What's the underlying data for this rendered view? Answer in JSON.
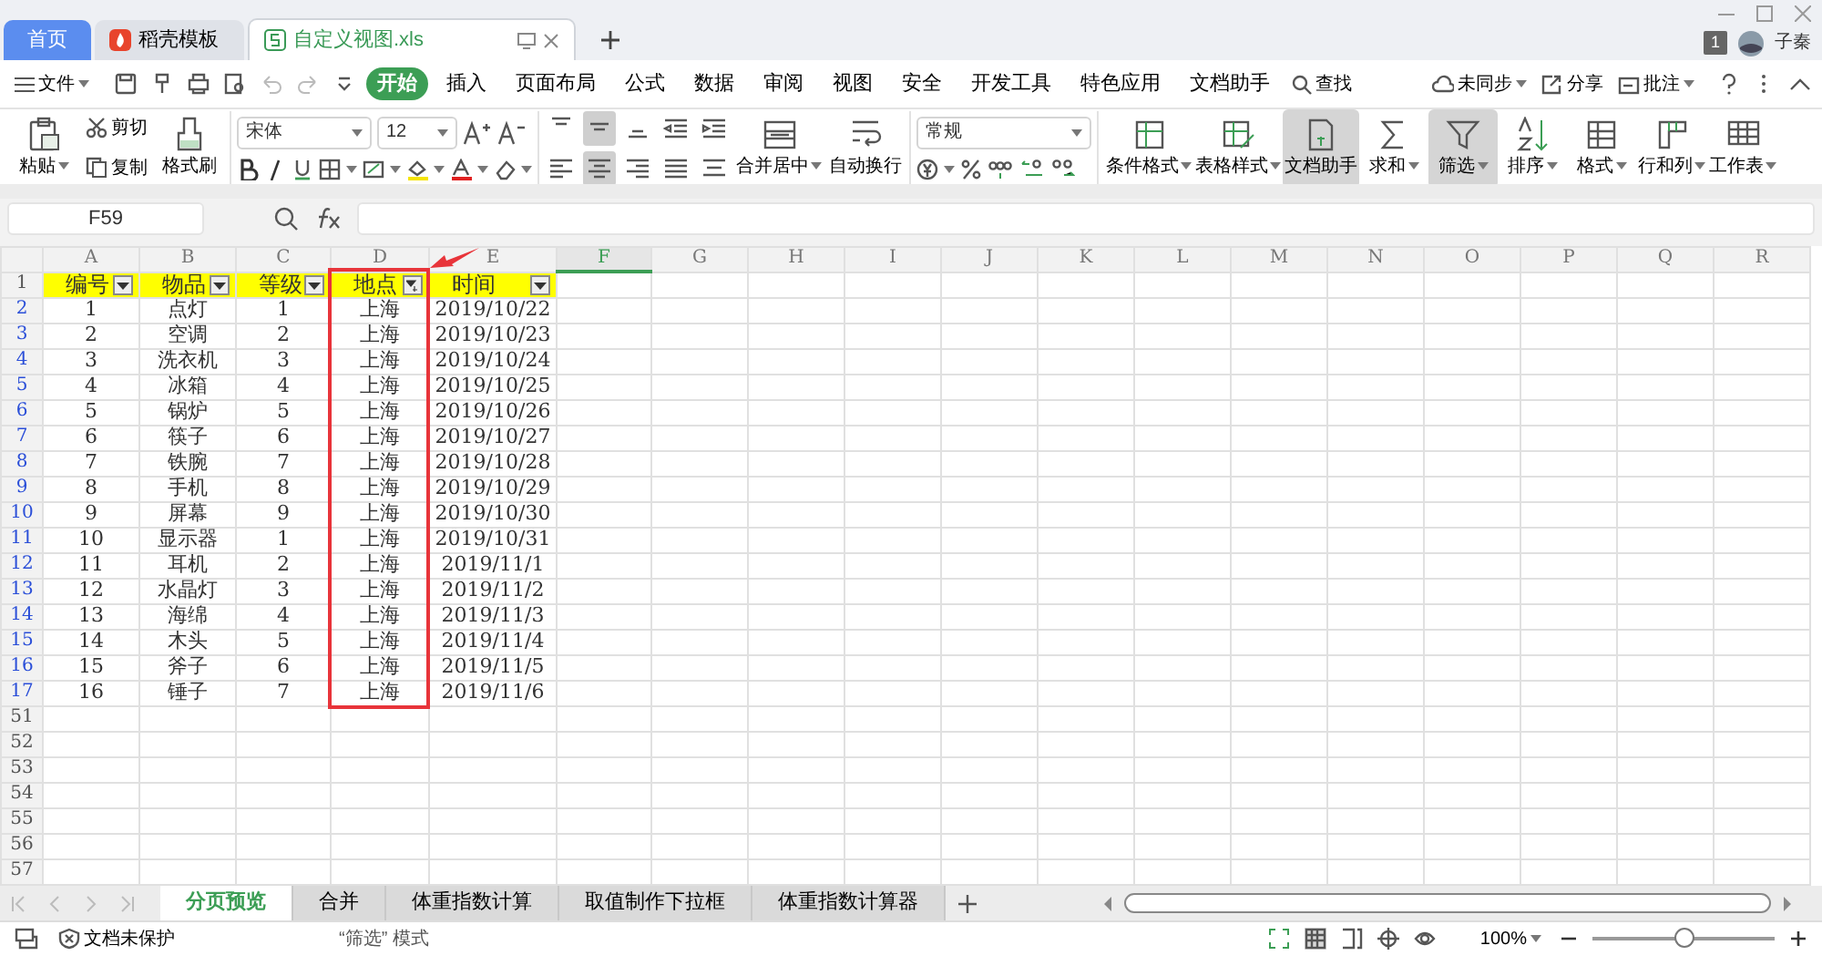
{
  "window": {
    "tabs": [
      {
        "label": "首页",
        "selected": false,
        "kind": "home"
      },
      {
        "label": "稻壳模板",
        "selected": false,
        "kind": "docer"
      },
      {
        "label": "自定义视图.xls",
        "selected": true,
        "kind": "file"
      }
    ],
    "badge": "1",
    "user": "子秦"
  },
  "menu": {
    "file": "文件",
    "tabs": [
      {
        "label": "开始",
        "selected": true
      },
      {
        "label": "插入",
        "selected": false
      },
      {
        "label": "页面布局",
        "selected": false
      },
      {
        "label": "公式",
        "selected": false
      },
      {
        "label": "数据",
        "selected": false
      },
      {
        "label": "审阅",
        "selected": false
      },
      {
        "label": "视图",
        "selected": false
      },
      {
        "label": "安全",
        "selected": false
      },
      {
        "label": "开发工具",
        "selected": false
      },
      {
        "label": "特色应用",
        "selected": false
      },
      {
        "label": "文档助手",
        "selected": false
      }
    ],
    "search": "查找",
    "sync": "未同步",
    "share": "分享",
    "comment": "批注"
  },
  "ribbon": {
    "paste": "粘贴",
    "cut": "剪切",
    "copy": "复制",
    "format_painter": "格式刷",
    "font_name": "宋体",
    "font_size": "12",
    "align_icons": [
      {
        "selected": false
      },
      {
        "selected": true
      },
      {
        "selected": false
      },
      {
        "selected": false
      },
      {
        "selected": false
      },
      {
        "selected": false
      },
      {
        "selected": true
      },
      {
        "selected": false
      },
      {
        "selected": false
      },
      {
        "selected": false
      }
    ],
    "merge": "合并居中",
    "wrap": "自动换行",
    "number_format": "常规",
    "tools": [
      {
        "label": "条件格式",
        "selected": false,
        "dropdown": true
      },
      {
        "label": "表格样式",
        "selected": false,
        "dropdown": true
      },
      {
        "label": "文档助手",
        "selected": true,
        "dropdown": false
      },
      {
        "label": "求和",
        "selected": false,
        "dropdown": true
      },
      {
        "label": "筛选",
        "selected": true,
        "dropdown": true
      },
      {
        "label": "排序",
        "selected": false,
        "dropdown": true
      },
      {
        "label": "格式",
        "selected": false,
        "dropdown": true
      },
      {
        "label": "行和列",
        "selected": false,
        "dropdown": true
      },
      {
        "label": "工作表",
        "selected": false,
        "dropdown": true
      }
    ]
  },
  "formula_bar": {
    "cell_ref": "F59"
  },
  "sheet": {
    "columns": [
      {
        "letter": "A",
        "selected": false,
        "highlighted": false
      },
      {
        "letter": "B",
        "selected": false,
        "highlighted": false
      },
      {
        "letter": "C",
        "selected": false,
        "highlighted": false
      },
      {
        "letter": "D",
        "selected": false,
        "highlighted": true
      },
      {
        "letter": "E",
        "selected": false,
        "highlighted": false
      },
      {
        "letter": "F",
        "selected": true,
        "highlighted": false
      },
      {
        "letter": "G",
        "selected": false,
        "highlighted": false
      },
      {
        "letter": "H",
        "selected": false,
        "highlighted": false
      },
      {
        "letter": "I",
        "selected": false,
        "highlighted": false
      },
      {
        "letter": "J",
        "selected": false,
        "highlighted": false
      },
      {
        "letter": "K",
        "selected": false,
        "highlighted": false
      },
      {
        "letter": "L",
        "selected": false,
        "highlighted": false
      },
      {
        "letter": "M",
        "selected": false,
        "highlighted": false
      },
      {
        "letter": "N",
        "selected": false,
        "highlighted": false
      },
      {
        "letter": "O",
        "selected": false,
        "highlighted": false
      },
      {
        "letter": "P",
        "selected": false,
        "highlighted": false
      },
      {
        "letter": "Q",
        "selected": false,
        "highlighted": false
      },
      {
        "letter": "R",
        "selected": false,
        "highlighted": false
      }
    ],
    "header_row": {
      "number": "1",
      "cells": [
        {
          "text": "编号",
          "filtered": false
        },
        {
          "text": "物品",
          "filtered": false
        },
        {
          "text": "等级",
          "filtered": false
        },
        {
          "text": "地点",
          "filtered": true
        },
        {
          "text": "时间",
          "filtered": false
        }
      ]
    },
    "rows": [
      {
        "number": "2",
        "filtered": true,
        "cells": [
          "1",
          "点灯",
          "1",
          "上海",
          "2019/10/22"
        ]
      },
      {
        "number": "3",
        "filtered": true,
        "cells": [
          "2",
          "空调",
          "2",
          "上海",
          "2019/10/23"
        ]
      },
      {
        "number": "4",
        "filtered": true,
        "cells": [
          "3",
          "洗衣机",
          "3",
          "上海",
          "2019/10/24"
        ]
      },
      {
        "number": "5",
        "filtered": true,
        "cells": [
          "4",
          "冰箱",
          "4",
          "上海",
          "2019/10/25"
        ]
      },
      {
        "number": "6",
        "filtered": true,
        "cells": [
          "5",
          "锅炉",
          "5",
          "上海",
          "2019/10/26"
        ]
      },
      {
        "number": "7",
        "filtered": true,
        "cells": [
          "6",
          "筷子",
          "6",
          "上海",
          "2019/10/27"
        ]
      },
      {
        "number": "8",
        "filtered": true,
        "cells": [
          "7",
          "铁腕",
          "7",
          "上海",
          "2019/10/28"
        ]
      },
      {
        "number": "9",
        "filtered": true,
        "cells": [
          "8",
          "手机",
          "8",
          "上海",
          "2019/10/29"
        ]
      },
      {
        "number": "10",
        "filtered": true,
        "cells": [
          "9",
          "屏幕",
          "9",
          "上海",
          "2019/10/30"
        ]
      },
      {
        "number": "11",
        "filtered": true,
        "cells": [
          "10",
          "显示器",
          "1",
          "上海",
          "2019/10/31"
        ]
      },
      {
        "number": "12",
        "filtered": true,
        "cells": [
          "11",
          "耳机",
          "2",
          "上海",
          "2019/11/1"
        ]
      },
      {
        "number": "13",
        "filtered": true,
        "cells": [
          "12",
          "水晶灯",
          "3",
          "上海",
          "2019/11/2"
        ]
      },
      {
        "number": "14",
        "filtered": true,
        "cells": [
          "13",
          "海绵",
          "4",
          "上海",
          "2019/11/3"
        ]
      },
      {
        "number": "15",
        "filtered": true,
        "cells": [
          "14",
          "木头",
          "5",
          "上海",
          "2019/11/4"
        ]
      },
      {
        "number": "16",
        "filtered": true,
        "cells": [
          "15",
          "斧子",
          "6",
          "上海",
          "2019/11/5"
        ]
      },
      {
        "number": "17",
        "filtered": true,
        "cells": [
          "16",
          "锤子",
          "7",
          "上海",
          "2019/11/6"
        ]
      },
      {
        "number": "51",
        "filtered": false
      },
      {
        "number": "52",
        "filtered": false
      },
      {
        "number": "53",
        "filtered": false
      },
      {
        "number": "54",
        "filtered": false
      },
      {
        "number": "55",
        "filtered": false
      },
      {
        "number": "56",
        "filtered": false
      },
      {
        "number": "57",
        "filtered": false
      }
    ]
  },
  "sheet_tabs": [
    {
      "label": "分页预览",
      "selected": true
    },
    {
      "label": "合并",
      "selected": false
    },
    {
      "label": "体重指数计算",
      "selected": false
    },
    {
      "label": "取值制作下拉框",
      "selected": false
    },
    {
      "label": "体重指数计算器",
      "selected": false
    }
  ],
  "status_bar": {
    "protection": "文档未保护",
    "mode": "“筛选” 模式",
    "zoom": "100%",
    "zoom_slider": {
      "level": 0.5
    }
  }
}
